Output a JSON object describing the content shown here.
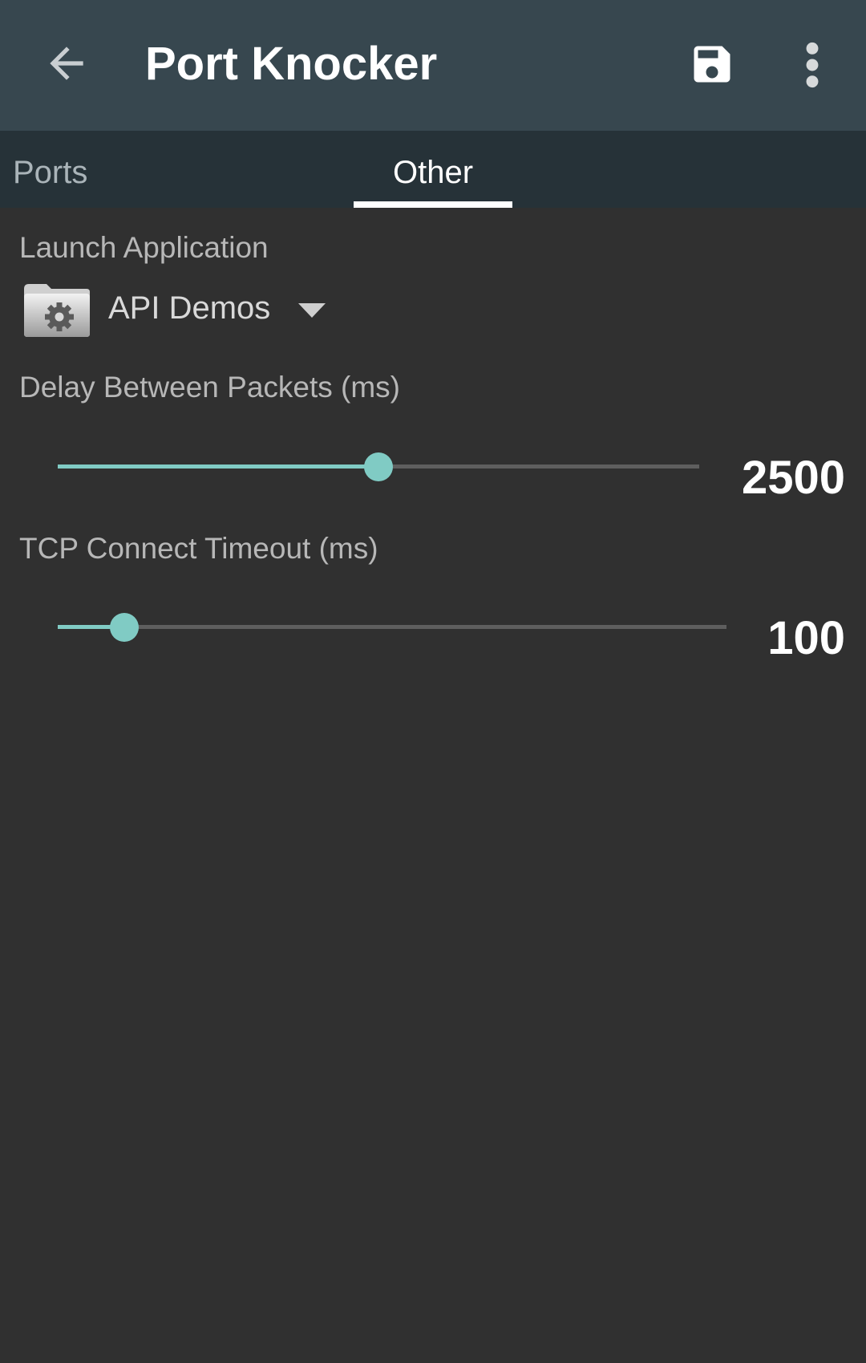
{
  "toolbar": {
    "title": "Port Knocker",
    "back_icon": "arrow-back-icon",
    "save_icon": "save-icon",
    "more_icon": "more-vert-icon",
    "background": "#37474f"
  },
  "tabs": [
    {
      "label": "Ports",
      "selected": false
    },
    {
      "label": "Other",
      "selected": true
    }
  ],
  "launch_application": {
    "label": "Launch Application",
    "selected_app": "API Demos",
    "app_icon": "folder-gear-icon"
  },
  "delay": {
    "label": "Delay Between Packets (ms)",
    "value": "2500",
    "fraction": 0.5
  },
  "timeout": {
    "label": "TCP Connect Timeout (ms)",
    "value": "100",
    "fraction": 0.1
  },
  "colors": {
    "accent": "#80cbc4",
    "background": "#303030",
    "tab_bar": "#263238"
  }
}
